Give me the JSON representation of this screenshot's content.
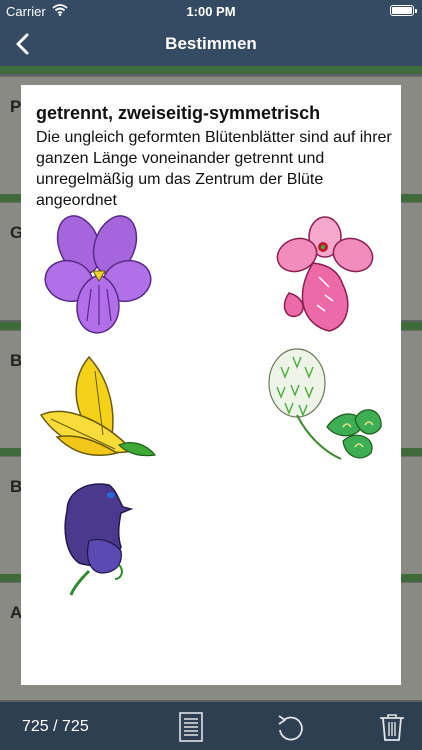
{
  "status_bar": {
    "carrier": "Carrier",
    "time": "1:00 PM"
  },
  "nav": {
    "title": "Bestimmen"
  },
  "background_letters": [
    "P",
    "G",
    "B",
    "B",
    "A"
  ],
  "modal": {
    "title": "getrennt, zweiseitig-symmetrisch",
    "description": "Die ungleich geformten Blütenblätter sind auf ihrer ganzen Länge voneinander getrennt und unregelmäßig um das Zentrum der Blüte angeordnet"
  },
  "toolbar": {
    "counter": "725 / 725"
  },
  "icons": [
    "back-chevron-icon",
    "wifi-icon",
    "battery-icon",
    "list-document-icon",
    "undo-rotate-icon",
    "trash-icon"
  ],
  "colors": {
    "bar": "#344b63",
    "toolbar": "#2f3f52",
    "modal": "#ffffff"
  }
}
